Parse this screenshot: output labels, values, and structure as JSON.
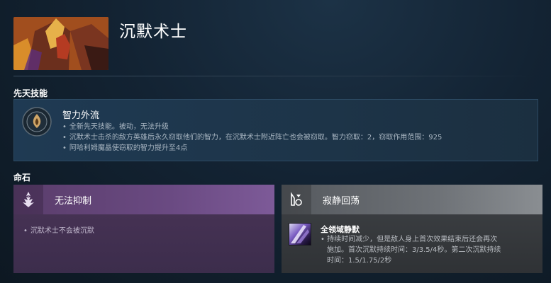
{
  "hero": {
    "name": "沉默术士"
  },
  "innate": {
    "section_title": "先天技能",
    "name": "智力外流",
    "lines": [
      "全新先天技能。被动，无法升级",
      "沉默术士击杀的敌方英雄后永久窃取他们的智力，在沉默术士附近阵亡也会被窃取。智力窃取：2，窃取作用范围：925",
      "阿哈利姆魔晶使窃取的智力提升至4点"
    ],
    "icon": "intelligence-drain-icon"
  },
  "facets": {
    "section_title": "命石",
    "left": {
      "title": "无法抑制",
      "icon": "unsuppressable-icon",
      "line": "沉默术士不会被沉默",
      "color": "#5a3d6b"
    },
    "right": {
      "title": "寂静回荡",
      "icon": "echoing-silence-icon",
      "ability_name": "全领域静默",
      "ability_icon": "global-silence-icon",
      "ability_line1": "• 持续时间减少，但是敌人身上首次效果结束后还会再次",
      "ability_line2": "施加。首次沉默持续时间：3/3.5/4秒。第二次沉默持续",
      "ability_line3": "时间：1.5/1.75/2秒",
      "color": "#6e7277"
    }
  }
}
